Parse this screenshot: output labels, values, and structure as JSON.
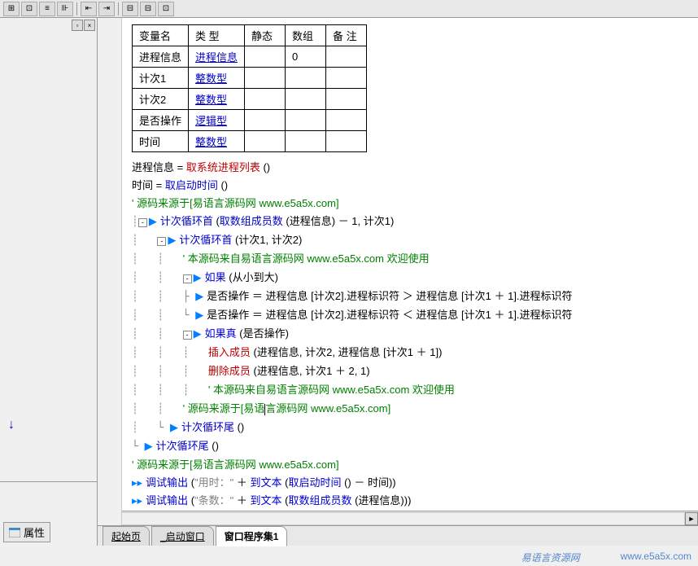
{
  "toolbar_icons": [
    "align-left",
    "align-center",
    "align-right",
    "align-just",
    "indent-left",
    "indent-right",
    "h-icon",
    "fit-1",
    "fit-2",
    "fit-3"
  ],
  "props_label": "属性",
  "table": {
    "headers": [
      "变量名",
      "类 型",
      "静态",
      "数组",
      "备 注"
    ],
    "rows": [
      {
        "name": "进程信息",
        "type": "进程信息",
        "static": "",
        "array": "0",
        "remark": ""
      },
      {
        "name": "计次1",
        "type": "整数型",
        "static": "",
        "array": "",
        "remark": ""
      },
      {
        "name": "计次2",
        "type": "整数型",
        "static": "",
        "array": "",
        "remark": ""
      },
      {
        "name": "是否操作",
        "type": "逻辑型",
        "static": "",
        "array": "",
        "remark": ""
      },
      {
        "name": "时间",
        "type": "整数型",
        "static": "",
        "array": "",
        "remark": ""
      }
    ]
  },
  "code": {
    "l1a": "进程信息",
    "l1eq": " = ",
    "l1b": "取系统进程列表",
    "l1c": " ()",
    "l2a": "时间",
    "l2eq": " = ",
    "l2b": "取启动时间",
    "l2c": " ()",
    "c1": "' 源码来源于[易语言源码网 www.e5a5x.com]",
    "loop1": "计次循环首",
    "loop1args": " (",
    "loop1f": "取数组成员数",
    "loop1rest": " (进程信息) － 1, 计次1)",
    "loop2": "计次循环首",
    "loop2args": " (计次1, 计次2)",
    "c2": "' 本源码来自易语言源码网 www.e5a5x.com 欢迎使用",
    "if1": "如果",
    "if1args": " (从小到大)",
    "as1a": "是否操作 ＝ 进程信息 [计次2].进程标识符 ＞ 进程信息 [计次1 ＋ 1].进程标识符",
    "as2a": "是否操作 ＝ 进程信息 [计次2].进程标识符 ＜ 进程信息 [计次1 ＋ 1].进程标识符",
    "ift": "如果真",
    "iftargs": " (是否操作)",
    "ins": "插入成员",
    "insargs": " (进程信息, 计次2, 进程信息 [计次1 ＋ 1])",
    "del": "删除成员",
    "delargs": " (进程信息, 计次1 ＋ 2, 1)",
    "c3": "' 本源码来自易语言源码网 www.e5a5x.com 欢迎使用",
    "c4a": "' 源码来源于[易语",
    "c4b": "言",
    "c4c": "源码网 www.e5a5x.com]",
    "loopend1": "计次循环尾",
    "loopendargs": " ()",
    "loopend2": "计次循环尾",
    "loopend2args": " ()",
    "c5": "' 源码来源于[易语言源码网 www.e5a5x.com]",
    "dbg": "调试输出",
    "dbg1a": " (",
    "dbg1s": "\"用时：\"",
    "dbg1b": " ＋ ",
    "dbg1f": "到文本",
    "dbg1c": " (",
    "dbg1f2": "取启动时间",
    "dbg1d": " () － 时间))",
    "dbg2a": " (",
    "dbg2s": "\"条数：\"",
    "dbg2b": " ＋ ",
    "dbg2f": "到文本",
    "dbg2c": " (",
    "dbg2f2": "取数组成员数",
    "dbg2d": " (进程信息)))"
  },
  "tabs": {
    "t1": "起始页",
    "t2": "_启动窗口",
    "t3": "窗口程序集1"
  },
  "footer": {
    "brand": "易语言资源网",
    "url": "www.e5a5x.com"
  }
}
